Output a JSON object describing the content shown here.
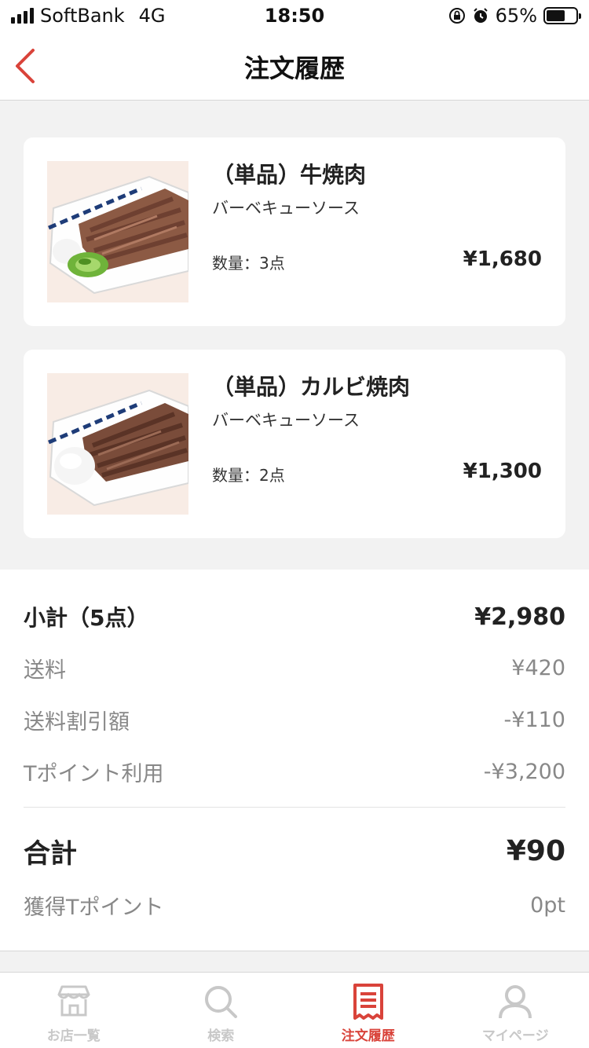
{
  "status_bar": {
    "carrier": "SoftBank",
    "network": "4G",
    "time": "18:50",
    "battery": "65%",
    "battery_level": 0.65
  },
  "nav": {
    "title": "注文履歴",
    "back_icon": "chevron-left-icon"
  },
  "items": [
    {
      "name": "（単品）牛焼肉",
      "option": "バーベキューソース",
      "qty_label": "数量：",
      "qty": "3点",
      "price": "¥1,680"
    },
    {
      "name": "（単品）カルビ焼肉",
      "option": "バーベキューソース",
      "qty_label": "数量：",
      "qty": "2点",
      "price": "¥1,300"
    }
  ],
  "summary": {
    "subtotal_label": "小計（5点）",
    "subtotal_value": "¥2,980",
    "shipping_label": "送料",
    "shipping_value": "¥420",
    "shipping_discount_label": "送料割引額",
    "shipping_discount_value": "-¥110",
    "tpoint_use_label": "Tポイント利用",
    "tpoint_use_value": "-¥3,200",
    "total_label": "合計",
    "total_value": "¥90",
    "earned_label": "獲得Tポイント",
    "earned_value": "0pt"
  },
  "tabbar": {
    "tabs": [
      {
        "label": "お店一覧",
        "icon": "store-icon",
        "active": false
      },
      {
        "label": "検索",
        "icon": "search-icon",
        "active": false
      },
      {
        "label": "注文履歴",
        "icon": "receipt-icon",
        "active": true
      },
      {
        "label": "マイページ",
        "icon": "person-icon",
        "active": false
      }
    ]
  },
  "colors": {
    "accent": "#d9433a",
    "background": "#f2f2f2",
    "muted_text": "#888888",
    "inactive_tab": "#c8c8c8"
  }
}
